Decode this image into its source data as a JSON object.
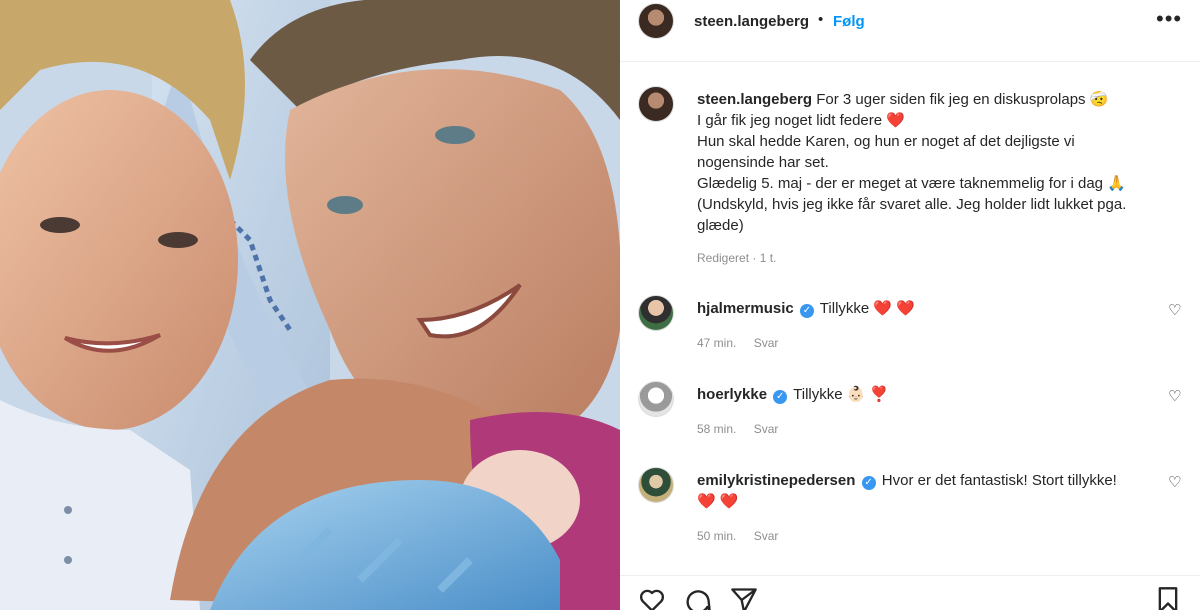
{
  "post": {
    "username": "steen.langeberg",
    "follow_label": "Følg",
    "more_icon": "more-icon",
    "caption": {
      "username": "steen.langeberg",
      "line1": "For 3 uger siden fik jeg en diskusprolaps 🤕",
      "line2": "I går fik jeg noget lidt federe",
      "line2_emoji": "❤️",
      "line3": "Hun skal hedde Karen, og hun er noget af det dejligste vi",
      "line4": "nogensinde har set.",
      "line5": "Glædelig 5. maj - der er meget at være taknemmelig for i dag 🙏",
      "line6": "(Undskyld, hvis jeg ikke får svaret alle. Jeg holder lidt lukket pga.",
      "line7": "glæde)",
      "meta": "Redigeret · 1 t."
    }
  },
  "comments": [
    {
      "username": "hjalmermusic",
      "text": "Tillykke",
      "emoji": "❤️ ❤️",
      "time": "47 min.",
      "reply": "Svar"
    },
    {
      "username": "hoerlykke",
      "text": "Tillykke",
      "emoji": "👶🏻 ❣️",
      "time": "58 min.",
      "reply": "Svar"
    },
    {
      "username": "emilykristinepedersen",
      "text": "Hvor er det fantastisk! Stort tillykke!",
      "emoji": "❤️ ❤️",
      "time": "50 min.",
      "reply": "Svar"
    }
  ],
  "actions": [
    "heart-icon",
    "comment-icon",
    "share-icon",
    "bookmark-icon"
  ],
  "colors": {
    "link": "#0095f6",
    "verified": "#3897f0",
    "heart": "#ed1c24",
    "muted": "#8e8e8e"
  }
}
